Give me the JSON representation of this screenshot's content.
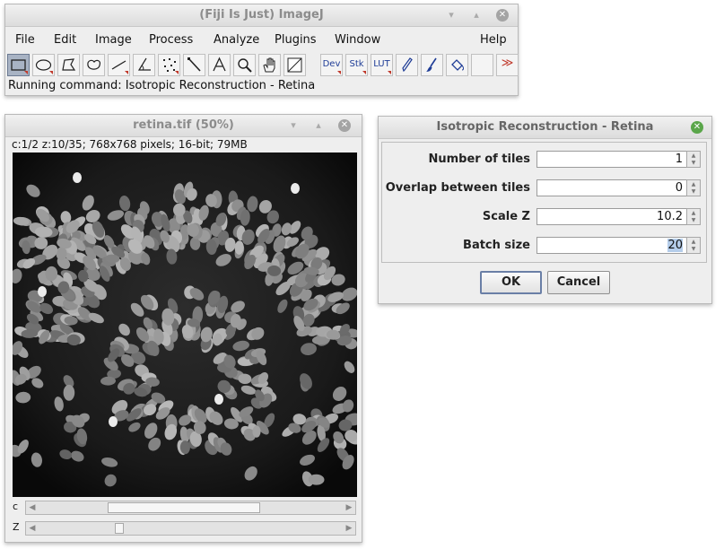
{
  "main_window": {
    "title": "(Fiji Is Just) ImageJ",
    "menus": [
      "File",
      "Edit",
      "Image",
      "Process",
      "Analyze",
      "Plugins",
      "Window",
      "Help"
    ],
    "tools": {
      "rectangle": "rectangle-selection-icon",
      "oval": "oval-selection-icon",
      "polygon": "polygon-selection-icon",
      "freehand": "freehand-selection-icon",
      "line": "line-selection-icon",
      "angle": "angle-tool-icon",
      "multipoint": "multipoint-tool-icon",
      "wand": "wand-tool-icon",
      "text": "text-tool-icon",
      "zoom": "magnifier-icon",
      "hand": "hand-tool-icon",
      "color": "color-picker-icon",
      "dev": "Dev",
      "stk": "Stk",
      "lut": "LUT",
      "pencil": "pencil-icon",
      "brush": "brush-icon",
      "flood": "flood-fill-icon",
      "more": "≫"
    },
    "status": "Running command: Isotropic Reconstruction - Retina"
  },
  "image_window": {
    "title": "retina.tif (50%)",
    "info": "c:1/2 z:10/35; 768x768 pixels; 16-bit; 79MB",
    "channel_label": "c",
    "z_label": "Z",
    "channel_position": 0.5,
    "z_position": 0.27
  },
  "dialog": {
    "title": "Isotropic Reconstruction - Retina",
    "fields": [
      {
        "label": "Number of tiles",
        "value": "1"
      },
      {
        "label": "Overlap between tiles",
        "value": "0"
      },
      {
        "label": "Scale Z",
        "value": "10.2"
      },
      {
        "label": "Batch size",
        "value": "20"
      }
    ],
    "ok_label": "OK",
    "cancel_label": "Cancel"
  },
  "colors": {
    "accent_close": "#5aa64a",
    "selection": "#b5cdea"
  }
}
